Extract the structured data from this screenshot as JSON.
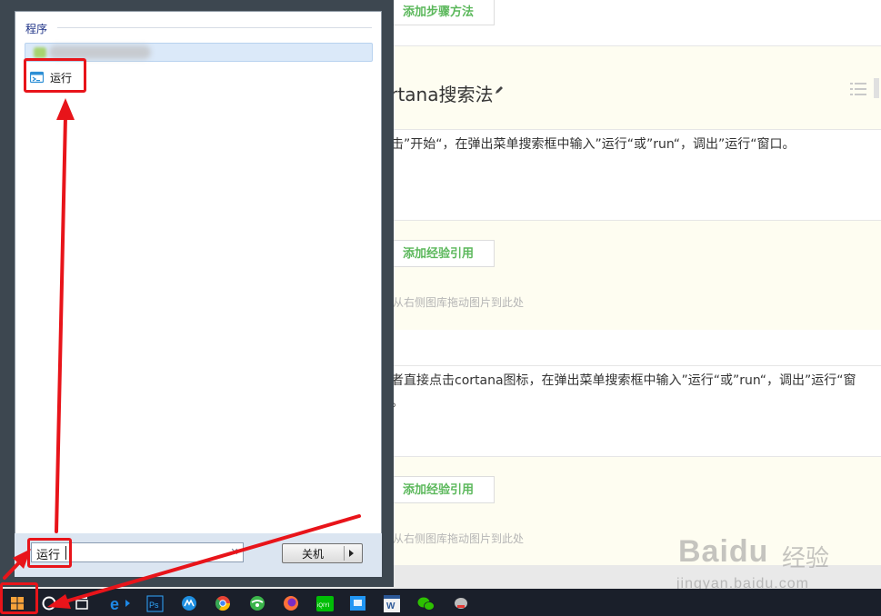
{
  "editor": {
    "add_step_method_label": "添加步骤方法",
    "method_title": "cortana搜索法",
    "step1_text": "点击”开始“，在弹出菜单搜索框中输入”运行“或”run“，调出”运行“窗口。",
    "add_ref_label_1": "添加经验引用",
    "drag_hint_1": "从右侧图库拖动图片到此处",
    "step2_text": "或者直接点击cortana图标，在弹出菜单搜索框中输入”运行“或”run“，调出”运行“窗口。",
    "add_ref_label_2": "添加经验引用",
    "drag_hint_2": "从右侧图库拖动图片到此处"
  },
  "watermark": {
    "logo": "Baidu",
    "cn": "经验",
    "url": "jingyan.baidu.com"
  },
  "start_menu": {
    "programs_header": "程序",
    "run_item_label": "运行",
    "search_value": "运行",
    "shutdown_label": "关机"
  },
  "taskbar": {
    "icons": [
      "windows-start-icon",
      "cortana-icon",
      "task-view-icon",
      "ie-icon",
      "photoshop-icon",
      "kugou-icon",
      "chrome-icon",
      "360-browser-icon",
      "firefox-icon",
      "iqiyi-icon",
      "app-icon",
      "word-icon",
      "wechat-icon",
      "app-icon-2"
    ],
    "photoshop_text": "Ps",
    "iqiyi_text": "iQIYI",
    "word_text": "W"
  },
  "colors": {
    "annotation_red": "#e8141a",
    "accent_green": "#5cb85c",
    "start_frame": "#3d4750",
    "taskbar": "#1a1f2a"
  }
}
